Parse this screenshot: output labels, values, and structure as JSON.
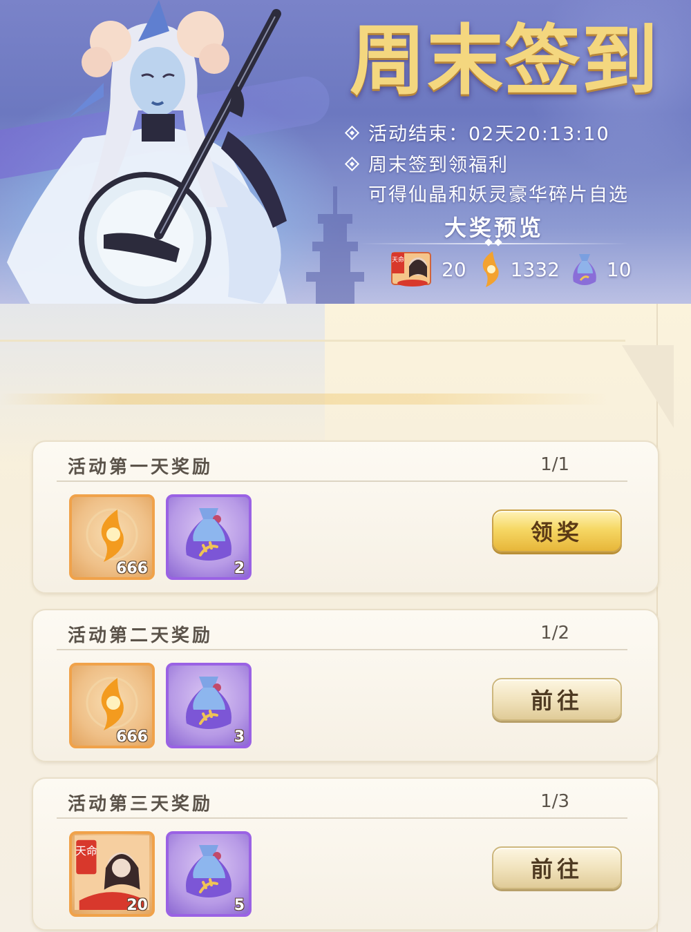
{
  "banner": {
    "title": "周末签到",
    "countdown_label": "活动结束：",
    "countdown_value": "02天20:13:10",
    "desc_line1": "周末签到领福利",
    "desc_line2": "可得仙晶和妖灵豪华碎片自选",
    "preview_title": "大奖预览",
    "preview_items": [
      {
        "icon": "hero-card-icon",
        "badge": "天命",
        "count": "20"
      },
      {
        "icon": "spirit-crystal-icon",
        "count": "1332"
      },
      {
        "icon": "blessing-bag-icon",
        "count": "10"
      }
    ]
  },
  "colors": {
    "title_gold": "#f4d77f",
    "gold_frame": "#f0a24a",
    "purple_frame": "#9a62e4",
    "button_gold": "#f6d865",
    "button_cream": "#f1e3bd"
  },
  "rewards": [
    {
      "title": "活动第一天奖励",
      "progress": "1/1",
      "items": [
        {
          "icon": "spirit-crystal-icon",
          "count": "666"
        },
        {
          "icon": "blessing-bag-icon",
          "count": "2"
        }
      ],
      "button": "领奖"
    },
    {
      "title": "活动第二天奖励",
      "progress": "1/2",
      "items": [
        {
          "icon": "spirit-crystal-icon",
          "count": "666"
        },
        {
          "icon": "blessing-bag-icon",
          "count": "3"
        }
      ],
      "button": "前往"
    },
    {
      "title": "活动第三天奖励",
      "progress": "1/3",
      "items": [
        {
          "icon": "hero-card-icon",
          "badge": "天命",
          "count": "20"
        },
        {
          "icon": "blessing-bag-icon",
          "count": "5"
        }
      ],
      "button": "前往"
    }
  ]
}
